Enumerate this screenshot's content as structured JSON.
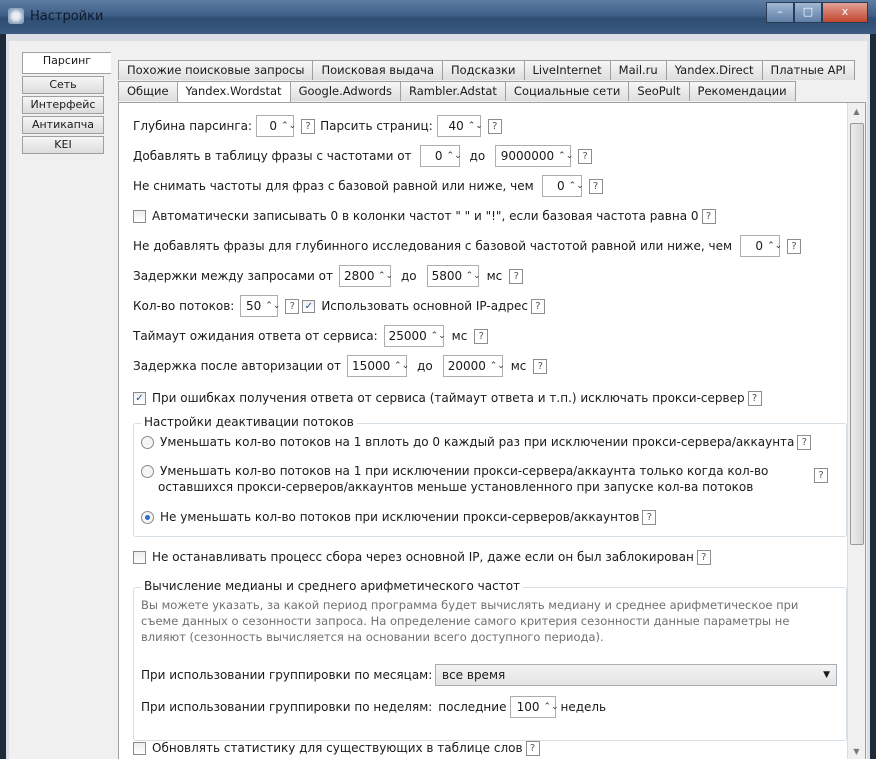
{
  "window": {
    "title": "Настройки",
    "min": "–",
    "max": "□",
    "close": "x"
  },
  "side_tabs": [
    "Парсинг",
    "Сеть",
    "Интерфейс",
    "Антикапча",
    "KEI"
  ],
  "tabs_row1": [
    "Похожие поисковые запросы",
    "Поисковая выдача",
    "Подсказки",
    "LiveInternet",
    "Mail.ru",
    "Yandex.Direct",
    "Платные API"
  ],
  "tabs_row2": [
    "Общие",
    "Yandex.Wordstat",
    "Google.Adwords",
    "Rambler.Adstat",
    "Социальные сети",
    "SeoPult",
    "Рекомендации"
  ],
  "help": "?",
  "check": "✓",
  "spin_up_down": "⌃⌄",
  "form": {
    "depth_label": "Глубина парсинга:",
    "depth_value": "0",
    "pages_label": "Парсить страниц:",
    "pages_value": "40",
    "add_label": "Добавлять в таблицу фразы с частотами от",
    "add_from": "0",
    "to": "до",
    "add_to": "9000000",
    "nofreq_label": "Не снимать частоты для фраз с базовой равной или ниже, чем",
    "nofreq_value": "0",
    "auto_zero_label": "Автоматически записывать 0 в колонки частот \" \" и \"!\", если базовая частота равна 0",
    "deep_label": "Не добавлять фразы для глубинного исследования с базовой частотой равной или ниже, чем",
    "deep_value": "0",
    "delay_label": "Задержки между запросами от",
    "delay_from": "2800",
    "delay_to": "5800",
    "ms": "мс",
    "threads_label": "Кол-во потоков:",
    "threads_value": "50",
    "main_ip_label": "Использовать основной IP-адрес",
    "timeout_label": "Таймаут ожидания ответа от сервиса:",
    "timeout_value": "25000",
    "auth_label": "Задержка после авторизации от",
    "auth_from": "15000",
    "auth_to": "20000",
    "exclude_proxy_label": "При ошибках получения ответа от сервиса (таймаут ответа и т.п.) исключать прокси-сервер",
    "deact_title": "Настройки деактивации потоков",
    "deact_opt1": "Уменьшать кол-во потоков на 1 вплоть до 0 каждый раз при исключении прокси-сервера/аккаунта",
    "deact_opt2a": "Уменьшать кол-во потоков на 1 при исключении прокси-сервера/аккаунта только когда кол-во",
    "deact_opt2b": "оставшихся прокси-серверов/аккаунтов меньше установленного при запуске кол-ва потоков",
    "deact_opt3": "Не уменьшать кол-во потоков при исключении прокси-серверов/аккаунтов",
    "nostop_label": "Не останавливать процесс сбора через основной IP, даже если он был заблокирован",
    "median_title": "Вычисление медианы и среднего арифметического частот",
    "median_desc1": "Вы можете указать, за какой период программа будет вычислять медиану и среднее арифметическое при",
    "median_desc2": "съеме данных о сезонности запроса. На определение самого критерия сезонности данные параметры не",
    "median_desc3": "влияют (сезонность вычисляется на основании всего доступного периода).",
    "months_label": "При использовании группировки по месяцам:",
    "months_value": "все время",
    "weeks_label": "При использовании группировки по неделям:",
    "weeks_last": "последние",
    "weeks_value": "100",
    "weeks_unit": "недель",
    "update_label": "Обновлять статистику для существующих в таблице слов"
  }
}
